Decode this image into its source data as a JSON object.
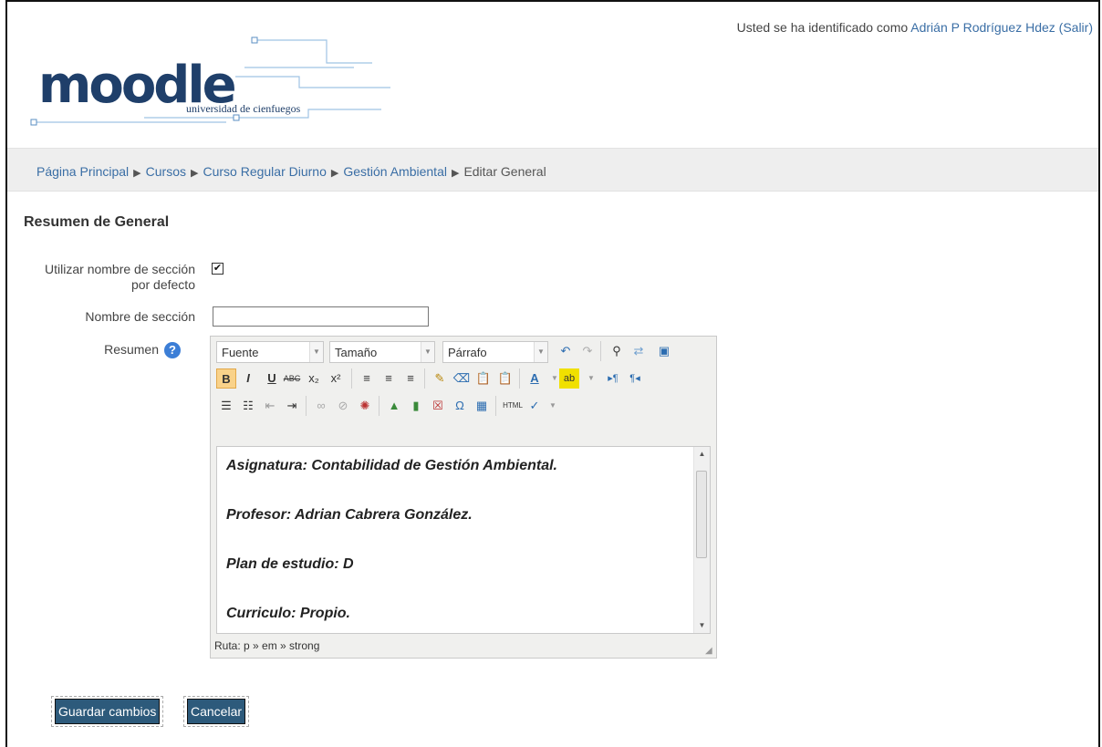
{
  "header": {
    "logo_text": "moodle",
    "logo_subtitle": "universidad de cienfuegos",
    "login_prefix": "Usted se ha identificado como ",
    "user_name": "Adrián P Rodríguez Hdez",
    "logout_link": "(Salir)"
  },
  "breadcrumb": {
    "items": [
      "Página Principal",
      "Cursos",
      "Curso Regular Diurno",
      "Gestión Ambiental"
    ],
    "current": "Editar General",
    "separator": "▶"
  },
  "form": {
    "title": "Resumen de General",
    "use_default_label": "Utilizar nombre de sección por defecto",
    "use_default_checked": true,
    "section_name_label": "Nombre de sección",
    "section_name_value": "",
    "summary_label": "Resumen"
  },
  "editor": {
    "font_select": "Fuente",
    "size_select": "Tamaño",
    "format_select": "Párrafo",
    "content": [
      "Asignatura: Contabilidad de Gestión Ambiental.",
      "Profesor: Adrian Cabrera González.",
      "Plan de estudio: D",
      "Curriculo: Propio."
    ],
    "status_path": "Ruta: p » em » strong"
  },
  "buttons": {
    "save": "Guardar cambios",
    "cancel": "Cancelar"
  },
  "colors": {
    "link": "#3a6ea5",
    "button_bg": "#2d5a7b",
    "help_icon": "#3c7ed6"
  }
}
